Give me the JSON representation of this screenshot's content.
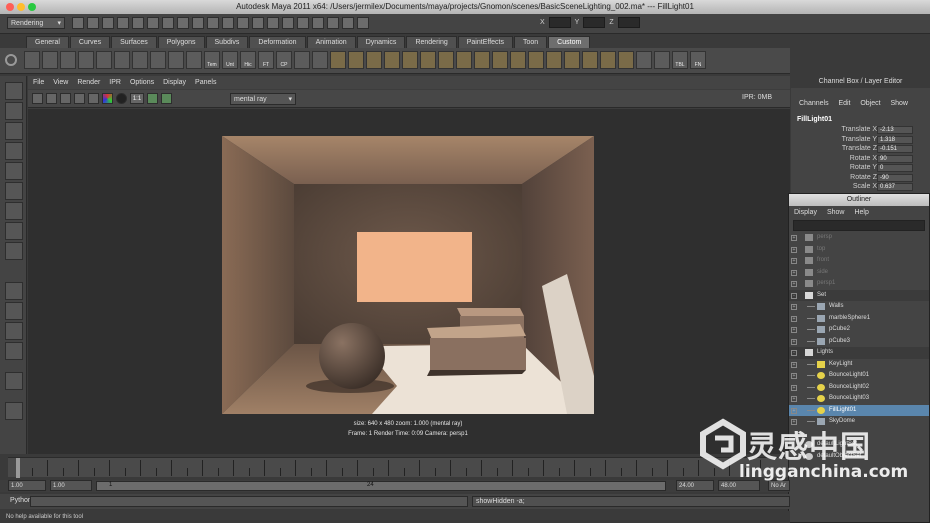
{
  "window": {
    "title": "Autodesk Maya 2011 x64: /Users/jermilex/Documents/maya/projects/Gnomon/scenes/BasicSceneLighting_002.ma*   ---   FillLight01",
    "traffic_colors": [
      "#ff5f57",
      "#ffbd2e",
      "#28c940"
    ]
  },
  "status_line": {
    "mode": "Rendering",
    "xyz_labels": [
      "X",
      "Y",
      "Z"
    ]
  },
  "shelf": {
    "tabs": [
      "General",
      "Curves",
      "Surfaces",
      "Polygons",
      "Subdivs",
      "Deformation",
      "Animation",
      "Dynamics",
      "Rendering",
      "PaintEffects",
      "Toon",
      "Custom"
    ],
    "active_tab": "Custom",
    "icon_labels": [
      "",
      "",
      "",
      "",
      "",
      "",
      "",
      "",
      "",
      "",
      "Tem",
      "Unt",
      "Hic",
      "FT",
      "CP",
      "",
      "",
      "",
      "",
      "",
      "",
      "",
      "",
      "",
      "",
      "",
      "",
      "",
      "",
      "",
      "",
      "",
      "",
      "",
      "",
      "",
      "TBL",
      "FN"
    ]
  },
  "panel": {
    "menu": [
      "File",
      "View",
      "Render",
      "IPR",
      "Options",
      "Display",
      "Panels"
    ],
    "ratio_label": "1:1",
    "renderer": "mental ray",
    "ipr_status": "IPR: 0MB",
    "render_info_line1": "size: 640 x 480 zoom: 1.000       (mental ray)",
    "render_info_line2": "Frame: 1      Render Time: 0:09      Camera: persp1"
  },
  "channel_box": {
    "title": "Channel Box / Layer Editor",
    "menu": [
      "Channels",
      "Edit",
      "Object",
      "Show"
    ],
    "node": "FillLight01",
    "rows": [
      {
        "label": "Translate X",
        "value": "-2.13"
      },
      {
        "label": "Translate Y",
        "value": "1.318"
      },
      {
        "label": "Translate Z",
        "value": "-0.151"
      },
      {
        "label": "Rotate X",
        "value": "90"
      },
      {
        "label": "Rotate Y",
        "value": "0"
      },
      {
        "label": "Rotate Z",
        "value": "-90"
      },
      {
        "label": "Scale X",
        "value": "0.637"
      }
    ]
  },
  "outliner": {
    "title": "Outliner",
    "menu": [
      "Display",
      "Show",
      "Help"
    ],
    "items": [
      {
        "name": "persp",
        "indent": 0,
        "expand": "+",
        "type": "camera",
        "state": "dim"
      },
      {
        "name": "top",
        "indent": 0,
        "expand": "+",
        "type": "camera",
        "state": "dim"
      },
      {
        "name": "front",
        "indent": 0,
        "expand": "+",
        "type": "camera",
        "state": "dim"
      },
      {
        "name": "side",
        "indent": 0,
        "expand": "+",
        "type": "camera",
        "state": "dim"
      },
      {
        "name": "persp1",
        "indent": 0,
        "expand": "+",
        "type": "camera",
        "state": "dim"
      },
      {
        "name": "Set",
        "indent": 0,
        "expand": "-",
        "type": "group",
        "state": "group"
      },
      {
        "name": "Walls",
        "indent": 1,
        "expand": "+",
        "type": "mesh",
        "state": ""
      },
      {
        "name": "marbleSphere1",
        "indent": 1,
        "expand": "+",
        "type": "mesh",
        "state": ""
      },
      {
        "name": "pCube2",
        "indent": 1,
        "expand": "+",
        "type": "mesh",
        "state": ""
      },
      {
        "name": "pCube3",
        "indent": 1,
        "expand": "+",
        "type": "mesh",
        "state": ""
      },
      {
        "name": "Lights",
        "indent": 0,
        "expand": "-",
        "type": "group",
        "state": "group"
      },
      {
        "name": "KeyLight",
        "indent": 1,
        "expand": "+",
        "type": "dirlight",
        "state": ""
      },
      {
        "name": "BounceLight01",
        "indent": 1,
        "expand": "+",
        "type": "light",
        "state": ""
      },
      {
        "name": "BounceLight02",
        "indent": 1,
        "expand": "+",
        "type": "light",
        "state": ""
      },
      {
        "name": "BounceLight03",
        "indent": 1,
        "expand": "+",
        "type": "light",
        "state": ""
      },
      {
        "name": "FillLight01",
        "indent": 1,
        "expand": "+",
        "type": "light",
        "state": "sel"
      },
      {
        "name": "SkyDome",
        "indent": 1,
        "expand": "+",
        "type": "mesh",
        "state": ""
      },
      {
        "name": "",
        "indent": 0,
        "expand": "",
        "type": "",
        "state": ""
      },
      {
        "name": "defaultLightSet",
        "indent": 0,
        "expand": "",
        "type": "set",
        "state": ""
      },
      {
        "name": "defaultObjectSet",
        "indent": 0,
        "expand": "",
        "type": "set",
        "state": ""
      }
    ]
  },
  "timeline": {
    "range_start": "1.00",
    "range_start_2": "1.00",
    "slider_start": "1",
    "slider_end": "24",
    "range_end": "24.00",
    "range_end_2": "48.00",
    "anim_layer": "No Ar"
  },
  "command_line": {
    "label": "Python",
    "result": "showHidden -a;",
    "help": "No help available for this tool"
  },
  "watermark": {
    "cn_text": "灵感中国",
    "url": "lingganchina.com"
  }
}
